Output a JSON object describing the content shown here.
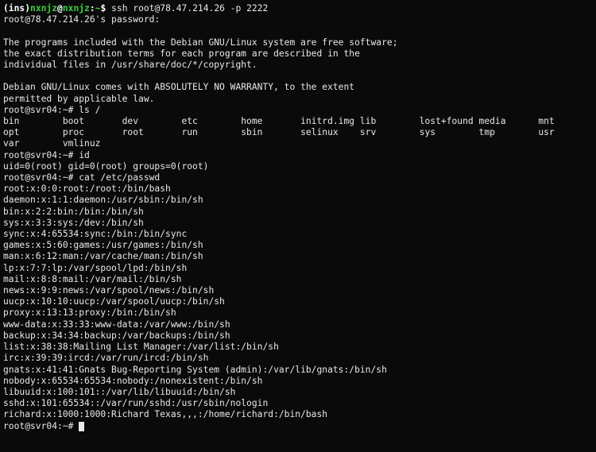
{
  "prompt1_ins": "(ins)",
  "prompt1_user": "nxnjz",
  "prompt1_at": "@",
  "prompt1_host": "nxnjz",
  "prompt1_sep": ":",
  "prompt1_path": "~",
  "prompt1_dollar": "$ ",
  "cmd_ssh": "ssh root@78.47.214.26 -p 2222",
  "password_prompt": "root@78.47.214.26's password:",
  "blank": "",
  "motd1": "The programs included with the Debian GNU/Linux system are free software;",
  "motd2": "the exact distribution terms for each program are described in the",
  "motd3": "individual files in /usr/share/doc/*/copyright.",
  "motd4": "Debian GNU/Linux comes with ABSOLUTELY NO WARRANTY, to the extent",
  "motd5": "permitted by applicable law.",
  "rp2": "root@svr04:~# ",
  "cmd_ls": "ls /",
  "ls_row1": "bin        boot       dev        etc        home       initrd.img lib        lost+found media      mnt",
  "ls_row2": "opt        proc       root       run        sbin       selinux    srv        sys        tmp        usr",
  "ls_row3": "var        vmlinuz",
  "cmd_id": "id",
  "id_out": "uid=0(root) gid=0(root) groups=0(root)",
  "cmd_cat": "cat /etc/passwd",
  "pw0": "root:x:0:0:root:/root:/bin/bash",
  "pw1": "daemon:x:1:1:daemon:/usr/sbin:/bin/sh",
  "pw2": "bin:x:2:2:bin:/bin:/bin/sh",
  "pw3": "sys:x:3:3:sys:/dev:/bin/sh",
  "pw4": "sync:x:4:65534:sync:/bin:/bin/sync",
  "pw5": "games:x:5:60:games:/usr/games:/bin/sh",
  "pw6": "man:x:6:12:man:/var/cache/man:/bin/sh",
  "pw7": "lp:x:7:7:lp:/var/spool/lpd:/bin/sh",
  "pw8": "mail:x:8:8:mail:/var/mail:/bin/sh",
  "pw9": "news:x:9:9:news:/var/spool/news:/bin/sh",
  "pw10": "uucp:x:10:10:uucp:/var/spool/uucp:/bin/sh",
  "pw11": "proxy:x:13:13:proxy:/bin:/bin/sh",
  "pw12": "www-data:x:33:33:www-data:/var/www:/bin/sh",
  "pw13": "backup:x:34:34:backup:/var/backups:/bin/sh",
  "pw14": "list:x:38:38:Mailing List Manager:/var/list:/bin/sh",
  "pw15": "irc:x:39:39:ircd:/var/run/ircd:/bin/sh",
  "pw16": "gnats:x:41:41:Gnats Bug-Reporting System (admin):/var/lib/gnats:/bin/sh",
  "pw17": "nobody:x:65534:65534:nobody:/nonexistent:/bin/sh",
  "pw18": "libuuid:x:100:101::/var/lib/libuuid:/bin/sh",
  "pw19": "sshd:x:101:65534::/var/run/sshd:/usr/sbin/nologin",
  "pw20": "richard:x:1000:1000:Richard Texas,,,:/home/richard:/bin/bash"
}
